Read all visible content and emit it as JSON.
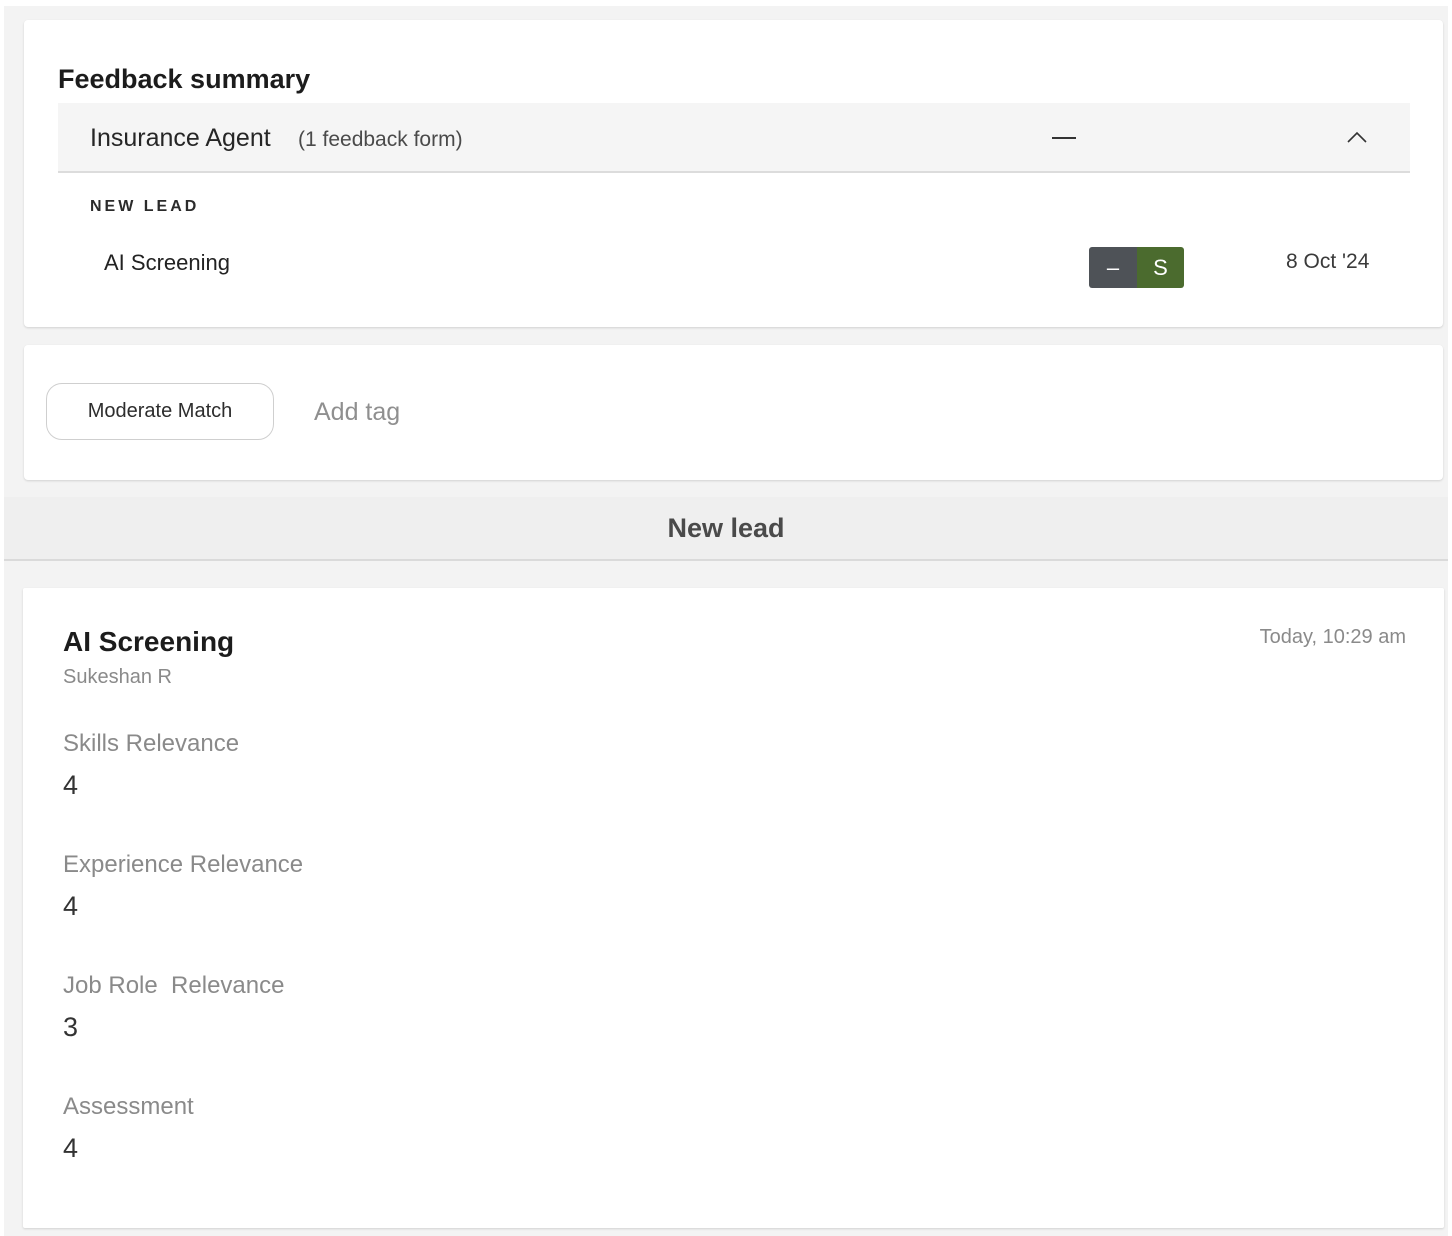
{
  "summary": {
    "title": "Feedback summary",
    "job": {
      "title": "Insurance Agent",
      "form_count": "(1 feedback form)",
      "rating_placeholder": "—",
      "expanded": true
    },
    "stage": "NEW LEAD",
    "forms": [
      {
        "name": "AI Screening",
        "badges": [
          {
            "label": "–",
            "color": "#4e5257"
          },
          {
            "label": "S",
            "color": "#4b6b2e"
          }
        ],
        "date": "8 Oct '24"
      }
    ]
  },
  "tags": {
    "chips": [
      "Moderate Match"
    ],
    "add_placeholder": "Add tag"
  },
  "stage_section": {
    "title": "New lead"
  },
  "detail": {
    "title": "AI Screening",
    "author": "Sukeshan R",
    "timestamp": "Today, 10:29 am",
    "fields": [
      {
        "label": "Skills Relevance",
        "value": "4"
      },
      {
        "label": "Experience Relevance",
        "value": "4"
      },
      {
        "label": "Job Role  Relevance",
        "value": "3"
      },
      {
        "label": "Assessment",
        "value": "4"
      }
    ]
  },
  "colors": {
    "badge_neutral": "#4e5257",
    "badge_strong": "#4b6b2e",
    "page_background": "#f3f3f3"
  }
}
